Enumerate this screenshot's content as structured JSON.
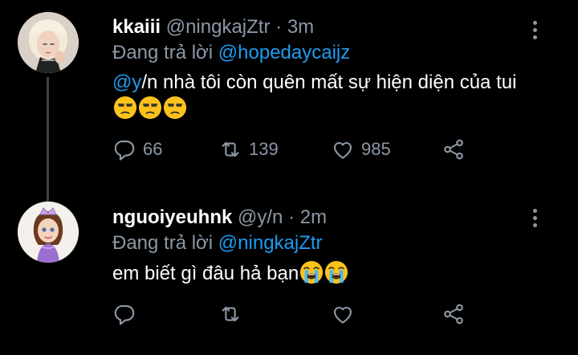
{
  "colors": {
    "background": "#000000",
    "accent": "#1d9bf0",
    "muted": "#8b98a5",
    "text": "#ffffff"
  },
  "tweets": [
    {
      "name": "kkaiii",
      "handle": "@ningkajZtr",
      "separator": "·",
      "time": "3m",
      "replying_prefix": "Đang trả lời",
      "replying_to": "@hopedaycaijz",
      "mention": "@y",
      "text": "/n nhà tôi còn quên mất sự hiện diện của tui",
      "emoji": [
        "unamused-face",
        "unamused-face",
        "unamused-face"
      ],
      "avatar": "profile-photo",
      "counts": {
        "replies": "66",
        "retweets": "139",
        "likes": "985"
      }
    },
    {
      "name": "nguoiyeuhnk",
      "handle": "@y/n",
      "separator": "·",
      "time": "2m",
      "replying_prefix": "Đang trả lời",
      "replying_to": "@ningkajZtr",
      "text": "em biết gì đâu hả bạn",
      "emoji": [
        "loudly-crying-face",
        "loudly-crying-face"
      ],
      "avatar": "princess-cartoon",
      "counts": {
        "replies": "",
        "retweets": "",
        "likes": ""
      }
    }
  ],
  "icons": {
    "reply": "reply-icon",
    "retweet": "retweet-icon",
    "like": "heart-icon",
    "share": "share-icon",
    "more": "more-vertical-icon"
  }
}
